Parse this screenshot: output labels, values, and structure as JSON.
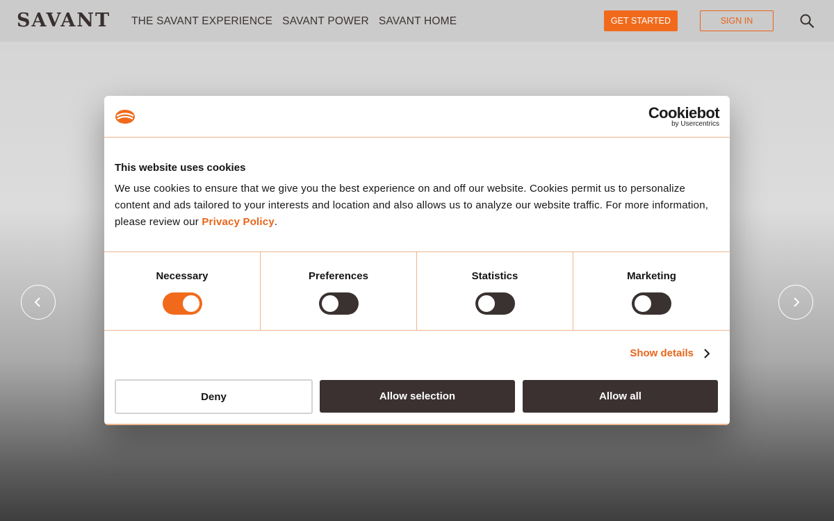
{
  "header": {
    "logo": "SAVANT",
    "nav": [
      "THE SAVANT EXPERIENCE",
      "SAVANT POWER",
      "SAVANT HOME"
    ],
    "get_started": "GET STARTED",
    "sign_in": "SIGN IN",
    "search_icon": "search-icon"
  },
  "carousel": {
    "prev_icon": "chevron-left-icon",
    "next_icon": "chevron-right-icon"
  },
  "cookie_dialog": {
    "brand_name": "Cookiebot",
    "brand_sub": "by Usercentrics",
    "title": "This website uses cookies",
    "text_before_link": "We use cookies to ensure that we give you the best experience on and off our website. Cookies permit us to personalize content and ads tailored to your interests and location and also allows us to analyze our website traffic.   For more information, please review our ",
    "link_text": "Privacy Policy",
    "text_after_link": ".",
    "categories": [
      {
        "label": "Necessary",
        "enabled": true
      },
      {
        "label": "Preferences",
        "enabled": false
      },
      {
        "label": "Statistics",
        "enabled": false
      },
      {
        "label": "Marketing",
        "enabled": false
      }
    ],
    "show_details": "Show details",
    "buttons": {
      "deny": "Deny",
      "allow_selection": "Allow selection",
      "allow_all": "Allow all"
    }
  },
  "colors": {
    "accent": "#f16a1c",
    "dark": "#3b3131"
  }
}
